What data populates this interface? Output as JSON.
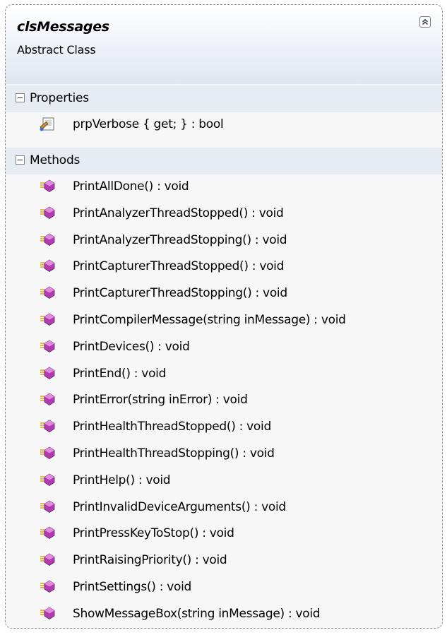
{
  "class": {
    "name": "clsMessages",
    "kind": "Abstract Class"
  },
  "sections": {
    "properties": {
      "label": "Properties",
      "items": [
        {
          "text": "prpVerbose { get; } : bool",
          "icon": "property-icon"
        }
      ]
    },
    "methods": {
      "label": "Methods",
      "items": [
        {
          "text": "PrintAllDone() : void",
          "icon": "method-icon"
        },
        {
          "text": "PrintAnalyzerThreadStopped() : void",
          "icon": "method-icon"
        },
        {
          "text": "PrintAnalyzerThreadStopping() : void",
          "icon": "method-icon"
        },
        {
          "text": "PrintCapturerThreadStopped() : void",
          "icon": "method-icon"
        },
        {
          "text": "PrintCapturerThreadStopping() : void",
          "icon": "method-icon"
        },
        {
          "text": "PrintCompilerMessage(string inMessage) : void",
          "icon": "method-icon"
        },
        {
          "text": "PrintDevices() : void",
          "icon": "method-icon"
        },
        {
          "text": "PrintEnd() : void",
          "icon": "method-icon"
        },
        {
          "text": "PrintError(string inError) : void",
          "icon": "method-icon"
        },
        {
          "text": "PrintHealthThreadStopped() : void",
          "icon": "method-icon"
        },
        {
          "text": "PrintHealthThreadStopping() : void",
          "icon": "method-icon"
        },
        {
          "text": "PrintHelp() : void",
          "icon": "method-icon"
        },
        {
          "text": "PrintInvalidDeviceArguments() : void",
          "icon": "method-icon"
        },
        {
          "text": "PrintPressKeyToStop() : void",
          "icon": "method-icon"
        },
        {
          "text": "PrintRaisingPriority() : void",
          "icon": "method-icon"
        },
        {
          "text": "PrintSettings() : void",
          "icon": "method-icon"
        },
        {
          "text": "ShowMessageBox(string inMessage) : void",
          "icon": "method-icon"
        }
      ]
    }
  },
  "colors": {
    "border": "#8f8f8f",
    "header_gradient_end": "#e0e6f1",
    "section_header": "#e7ebf2",
    "method_icon": "#b23bb2",
    "method_lines": "#d9a400"
  }
}
